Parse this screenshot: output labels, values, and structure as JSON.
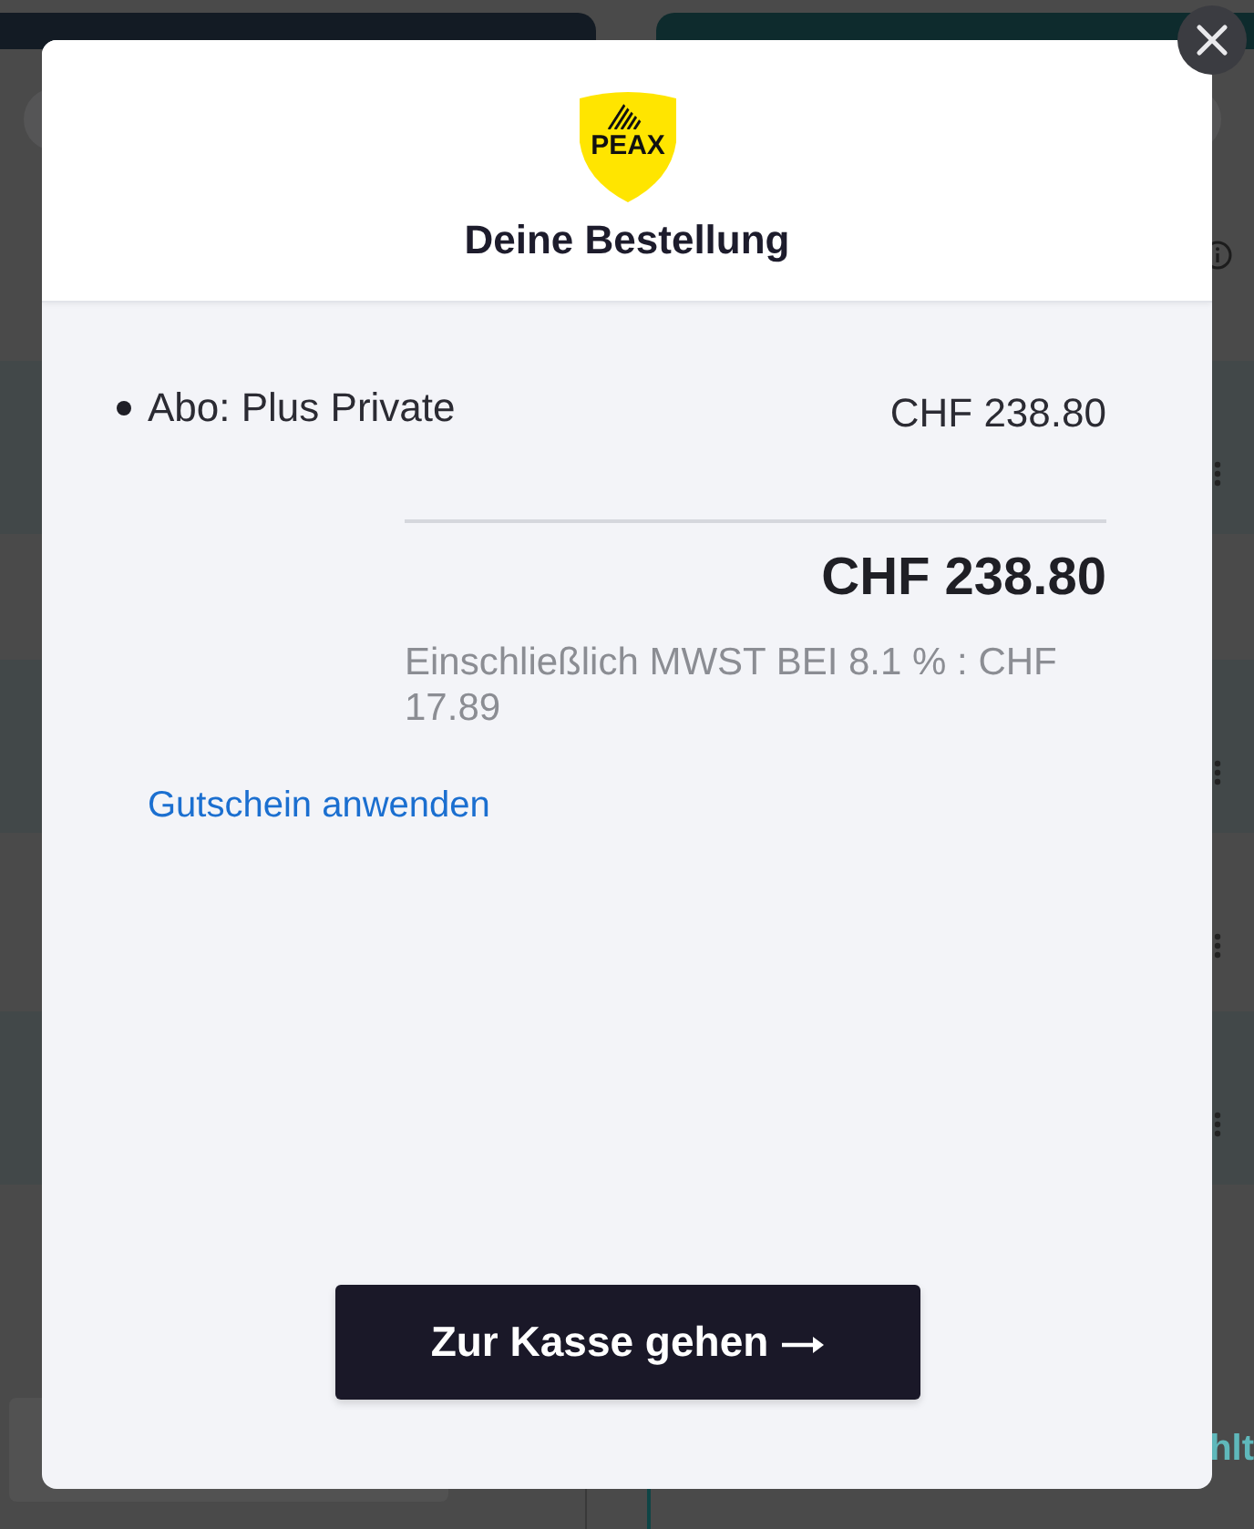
{
  "background": {
    "partial_label": "hlt"
  },
  "dialog": {
    "logo_text": "PEAX",
    "title": "Deine Bestellung",
    "items": [
      {
        "name": "Abo: Plus Private",
        "price": "CHF 238.80"
      }
    ],
    "total": "CHF 238.80",
    "tax_note": "Einschließlich MWST BEI 8.1 % : CHF 17.89",
    "coupon_link": "Gutschein anwenden",
    "checkout_button": "Zur Kasse gehen"
  }
}
